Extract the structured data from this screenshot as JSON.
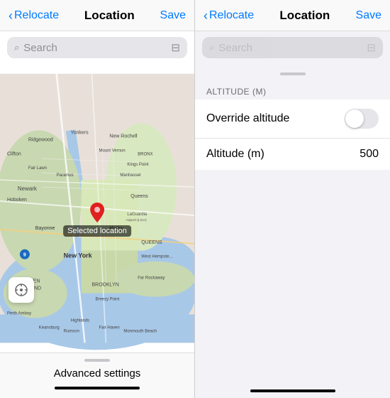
{
  "left": {
    "nav": {
      "back_label": "Relocate",
      "title": "Location",
      "save_label": "Save"
    },
    "search": {
      "placeholder": "Search",
      "icon": "🔍",
      "book_icon": "📖"
    },
    "map": {
      "selected_label": "Selected location",
      "pin_color": "#e02020"
    },
    "bottom": {
      "advanced_label": "Advanced settings",
      "drag_hint": "drag-handle"
    }
  },
  "right": {
    "nav": {
      "back_label": "Relocate",
      "title": "Location",
      "save_label": "Save"
    },
    "search": {
      "placeholder": "Search"
    },
    "altitude_section": {
      "header": "ALTITUDE (M)",
      "rows": [
        {
          "label": "Override altitude",
          "type": "toggle",
          "value": false
        },
        {
          "label": "Altitude (m)",
          "type": "value",
          "value": "500"
        }
      ]
    }
  }
}
